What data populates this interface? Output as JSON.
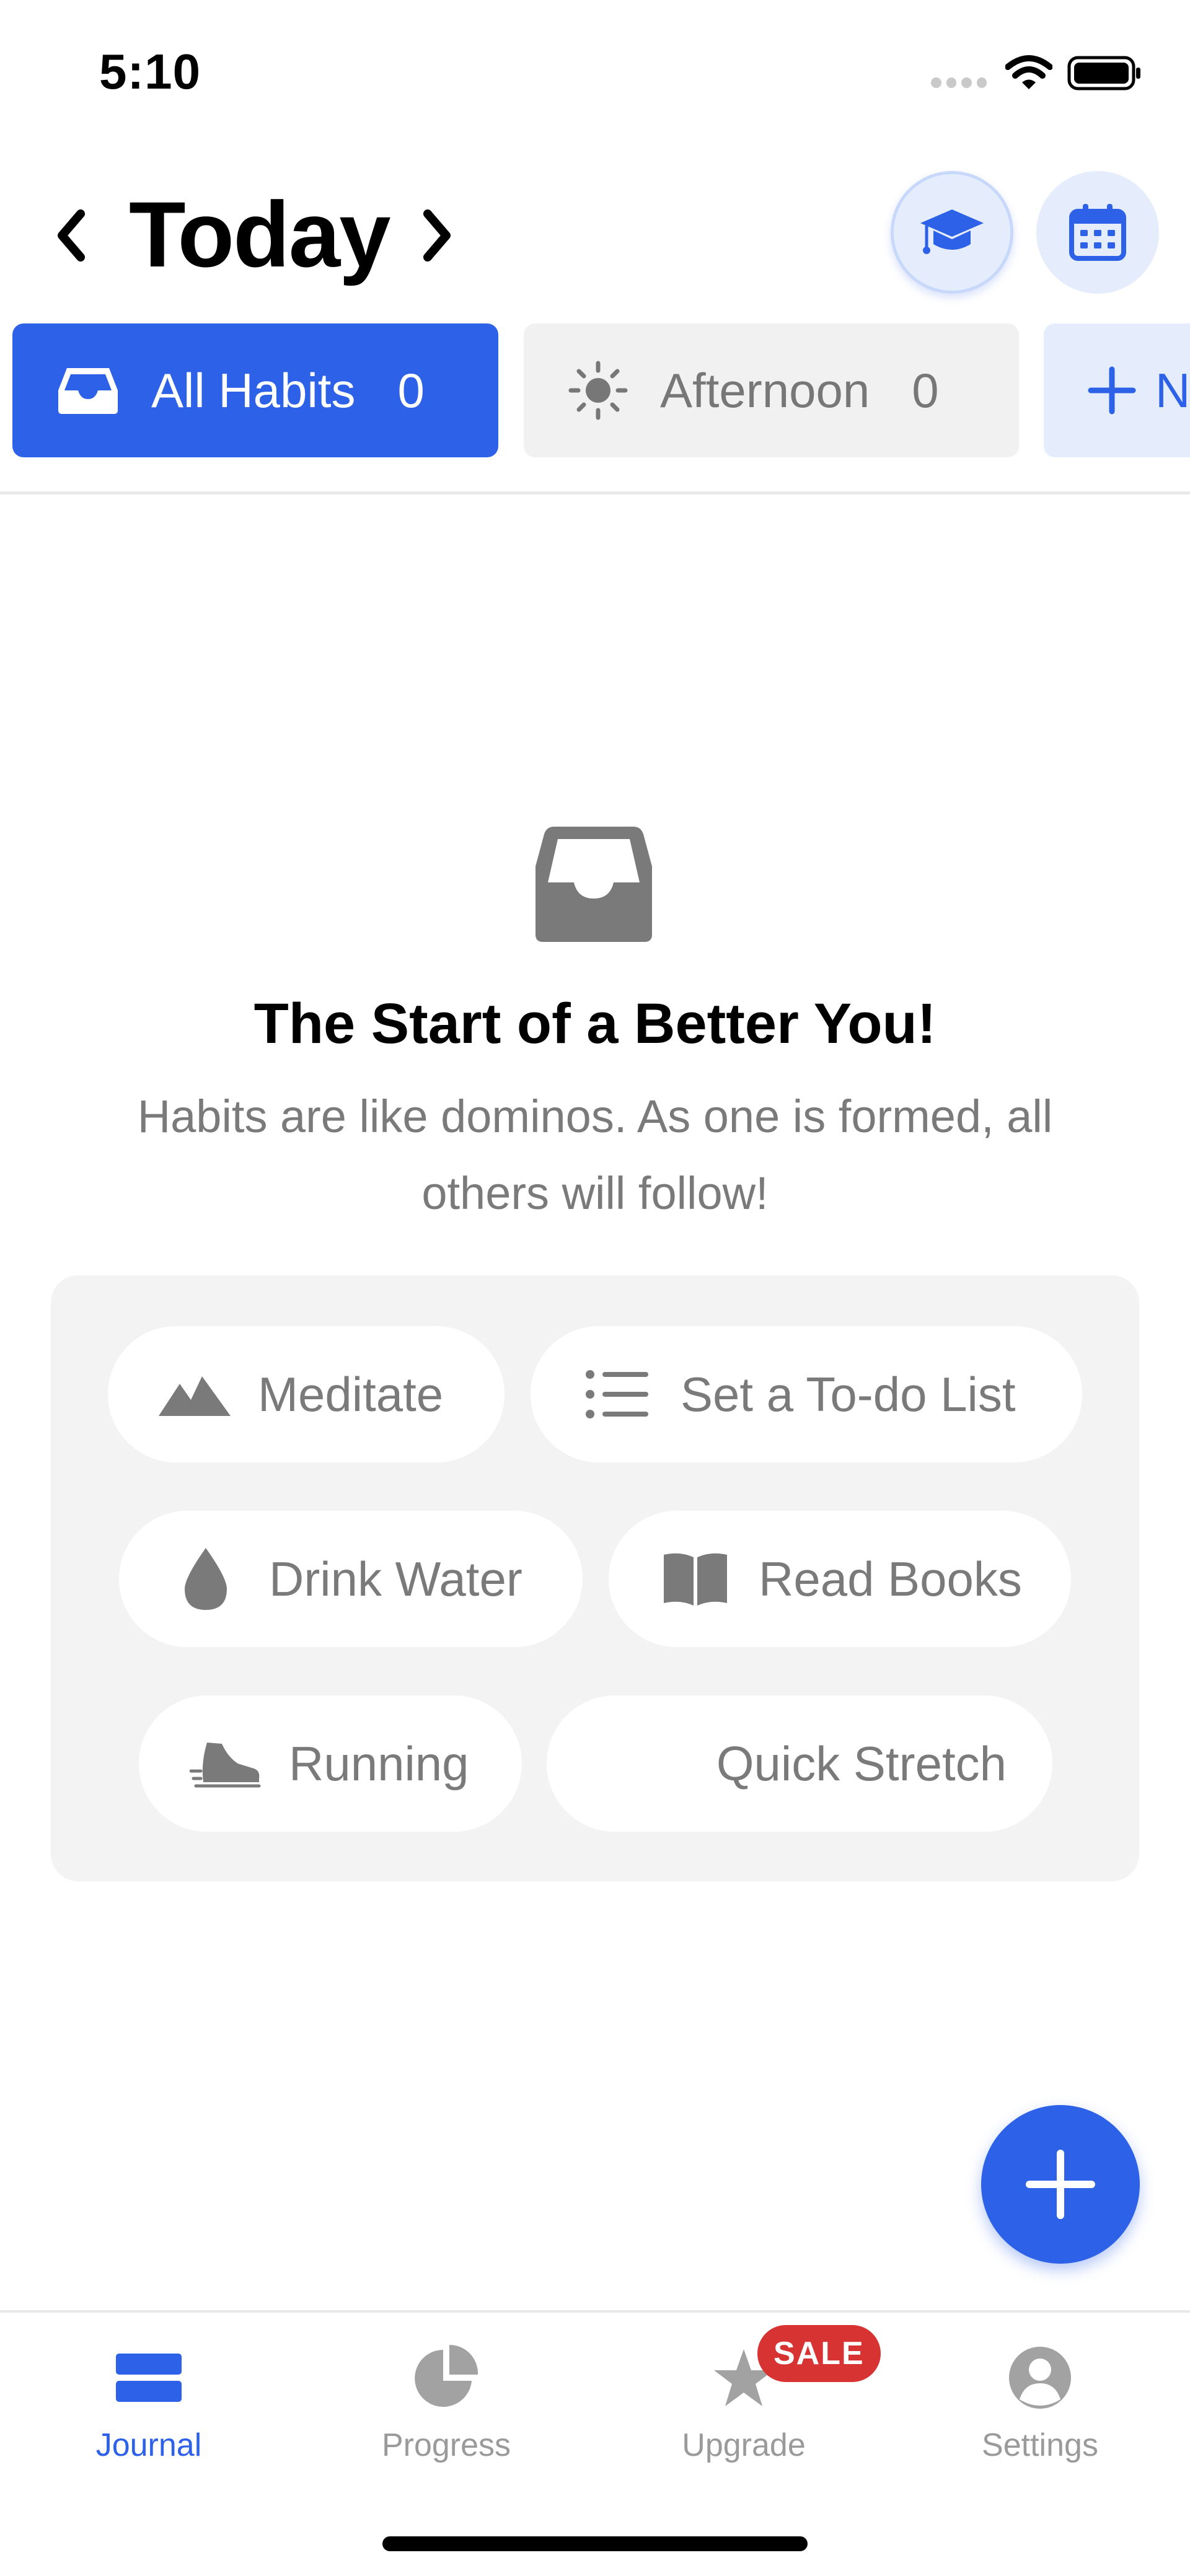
{
  "status_bar": {
    "time": "5:10"
  },
  "header": {
    "title": "Today"
  },
  "tabs": [
    {
      "label": "All Habits",
      "count": "0"
    },
    {
      "label": "Afternoon",
      "count": "0"
    },
    {
      "label": "N"
    }
  ],
  "empty_state": {
    "title": "The Start of a Better You!",
    "subtitle": "Habits are like dominos. As one is formed, all others will follow!"
  },
  "suggestions": [
    {
      "label": "Meditate",
      "icon": "mountain-icon"
    },
    {
      "label": "Set a To-do List",
      "icon": "list-icon"
    },
    {
      "label": "Drink Water",
      "icon": "water-drop-icon"
    },
    {
      "label": "Read Books",
      "icon": "book-icon"
    },
    {
      "label": "Running",
      "icon": "shoe-icon"
    },
    {
      "label": "Quick Stretch",
      "icon": ""
    }
  ],
  "tabbar": {
    "items": [
      {
        "label": "Journal",
        "icon": "journal-icon"
      },
      {
        "label": "Progress",
        "icon": "pie-chart-icon"
      },
      {
        "label": "Upgrade",
        "icon": "star-icon"
      },
      {
        "label": "Settings",
        "icon": "person-icon"
      }
    ],
    "sale_badge": "SALE",
    "active": "Journal"
  },
  "colors": {
    "accent": "#2d62e8",
    "accent_light": "#e5edfd",
    "muted_text": "#7a7a7a",
    "panel": "#f3f3f3",
    "sale": "#d73333"
  }
}
